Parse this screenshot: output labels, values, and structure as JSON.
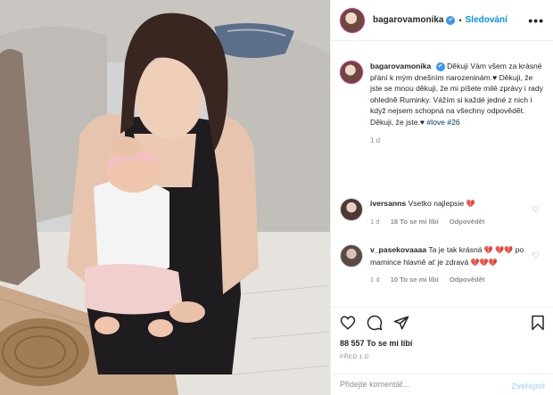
{
  "header": {
    "username": "bagarovamonika",
    "follow_label": "Sledování",
    "separator": "•",
    "more_label": "•••"
  },
  "caption": {
    "username": "bagarovamonika",
    "text": "Děkuji Vám všem za krásné přání k mým dnešním narozeninám.♥ Děkuji, že jste se mnou děkuji, že mi píšete milé zprávy i rady ohledně Ruminky. Vážím si každé jedné z nich i když nejsem schopná na všechny odpovědět. Děkuji, že jste.♥",
    "hashtags": "#love #26",
    "time": "1 d"
  },
  "comments": [
    {
      "username": "iversanns",
      "text": "Vsetko najlepsie",
      "emoji": "💔",
      "time": "1 d",
      "likes": "18 To se mi líbí",
      "reply": "Odpovědět"
    },
    {
      "username": "v_pasekovaaaa",
      "text_a": "Ta je tak krásná",
      "emoji_a": "💔",
      "emoji_b": "💔💔",
      "text_b": "po mamince hlavně ať je zdravá",
      "emoji_c": "💔💔💔",
      "time": "1 d",
      "likes": "10 To se mi líbí",
      "reply": "Odpovědět"
    }
  ],
  "likes_text": "88 557 To se mi líbí",
  "posted_ago": "PŘED 1 D",
  "add_comment": {
    "placeholder": "Přidejte komentář...",
    "post_label": "Zveřejnit"
  },
  "icons": {
    "verified": "✔",
    "heart": "♡"
  }
}
